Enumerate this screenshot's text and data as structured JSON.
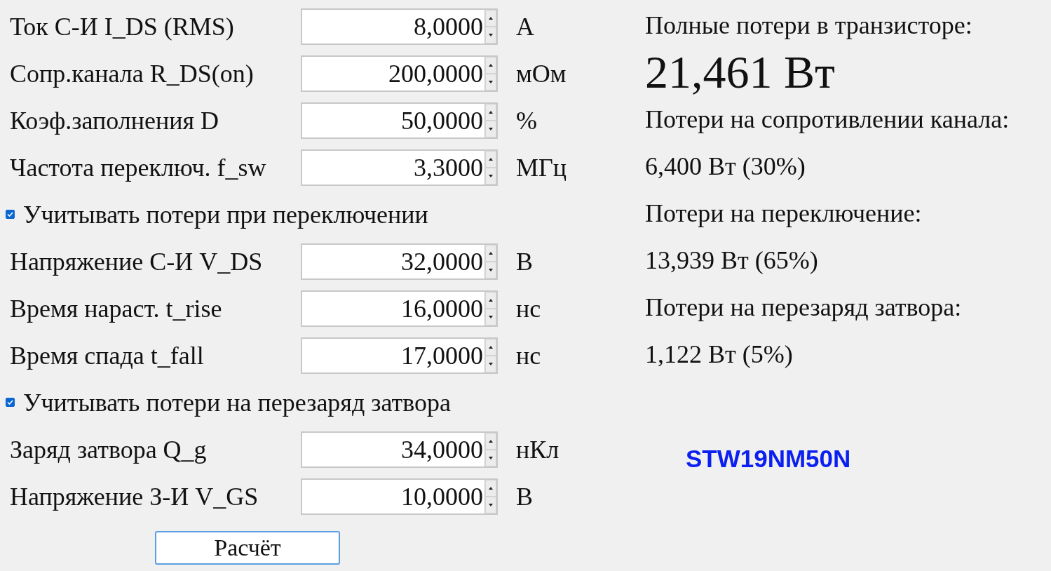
{
  "inputs": [
    {
      "kind": "field",
      "label": "Ток С-И I_DS (RMS)",
      "value": "8,0000",
      "unit": "А"
    },
    {
      "kind": "field",
      "label": "Сопр.канала R_DS(on)",
      "value": "200,0000",
      "unit": "мОм"
    },
    {
      "kind": "field",
      "label": "Коэф.заполнения  D",
      "value": "50,0000",
      "unit": "%"
    },
    {
      "kind": "field",
      "label": "Частота переключ. f_sw",
      "value": "3,3000",
      "unit": "МГц"
    },
    {
      "kind": "checkbox",
      "label": "Учитывать потери при переключении",
      "checked": true
    },
    {
      "kind": "field",
      "label": "Напряжение С-И V_DS",
      "value": "32,0000",
      "unit": "В"
    },
    {
      "kind": "field",
      "label": "Время нараст. t_rise",
      "value": "16,0000",
      "unit": "нс"
    },
    {
      "kind": "field",
      "label": "Время спада t_fall",
      "value": "17,0000",
      "unit": "нс"
    },
    {
      "kind": "checkbox",
      "label": "Учитывать потери на перезаряд затвора",
      "checked": true
    },
    {
      "kind": "field",
      "label": "Заряд затвора Q_g",
      "value": "34,0000",
      "unit": "нКл"
    },
    {
      "kind": "field",
      "label": "Напряжение З-И V_GS",
      "value": "10,0000",
      "unit": "В"
    }
  ],
  "calculate_button": "Расчёт",
  "results": [
    {
      "kind": "label",
      "text": "Полные потери в транзисторе:"
    },
    {
      "kind": "total",
      "text": "21,461 Вт"
    },
    {
      "kind": "label",
      "text": "Потери на сопротивлении канала:"
    },
    {
      "kind": "value",
      "text": "6,400 Вт (30%)"
    },
    {
      "kind": "label",
      "text": "Потери на переключение:"
    },
    {
      "kind": "value",
      "text": "13,939 Вт (65%)"
    },
    {
      "kind": "label",
      "text": "Потери на перезаряд затвора:"
    },
    {
      "kind": "value",
      "text": "1,122 Вт (5%)"
    }
  ],
  "part_number": "STW19NM50N"
}
